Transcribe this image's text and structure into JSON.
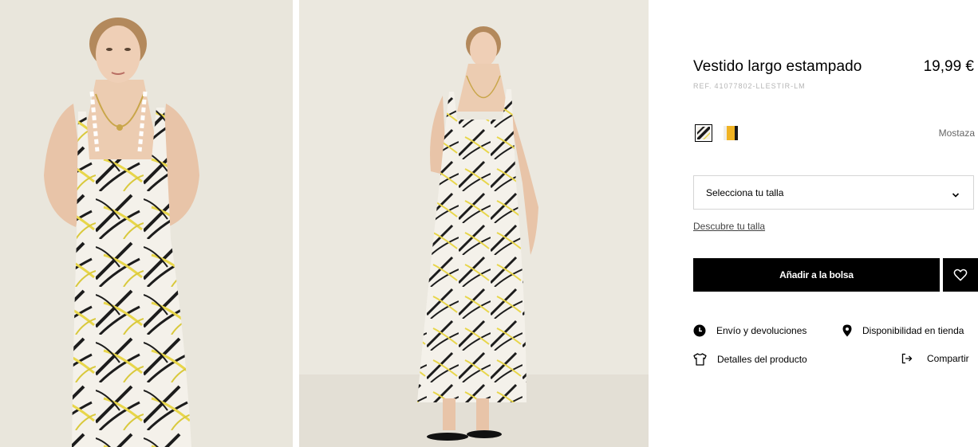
{
  "gallery": {
    "images": [
      {
        "name": "photo-front-closeup",
        "alt": "model-front-view"
      },
      {
        "name": "photo-full-body",
        "alt": "model-full-body-view"
      }
    ]
  },
  "product": {
    "title": "Vestido largo estampado",
    "price": "19,99 €",
    "ref_label": "REF.",
    "ref_code": "41077802-LLESTIR-LM"
  },
  "colors": {
    "selected_name": "Mostaza",
    "swatches": [
      {
        "name": "print",
        "selected": true,
        "color": "#1a1a1a"
      },
      {
        "name": "mustard",
        "selected": false,
        "color": "#f0b323"
      }
    ]
  },
  "size": {
    "placeholder": "Selecciona tu talla",
    "guide_link": "Descubre tu talla"
  },
  "actions": {
    "add_to_bag": "Añadir a la bolsa",
    "favorite_icon": "heart-icon"
  },
  "info_links": {
    "shipping": {
      "label": "Envío y devoluciones",
      "icon": "clock-icon"
    },
    "stock": {
      "label": "Disponibilidad en tienda",
      "icon": "location-pin-icon"
    },
    "details": {
      "label": "Detalles del producto",
      "icon": "tshirt-icon"
    },
    "share": {
      "label": "Compartir",
      "icon": "share-icon"
    }
  },
  "theme": {
    "accent": "#000000",
    "mustard": "#f0b323",
    "background_photo": "#e9e6dc"
  }
}
